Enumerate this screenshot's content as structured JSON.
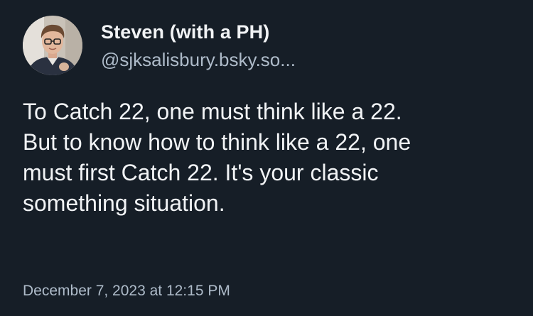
{
  "author": {
    "display_name": "Steven (with a PH)",
    "handle": "@sjksalisbury.bsky.so..."
  },
  "post": {
    "lines": [
      "To Catch 22, one must think like a 22.",
      "But to know how to think like a 22, one",
      "must first Catch 22. It's your classic",
      "something situation."
    ],
    "timestamp": "December 7, 2023 at 12:15 PM"
  },
  "colors": {
    "background": "#161e27",
    "primary_text": "#f1f3f5",
    "secondary_text": "#aebbc9"
  }
}
